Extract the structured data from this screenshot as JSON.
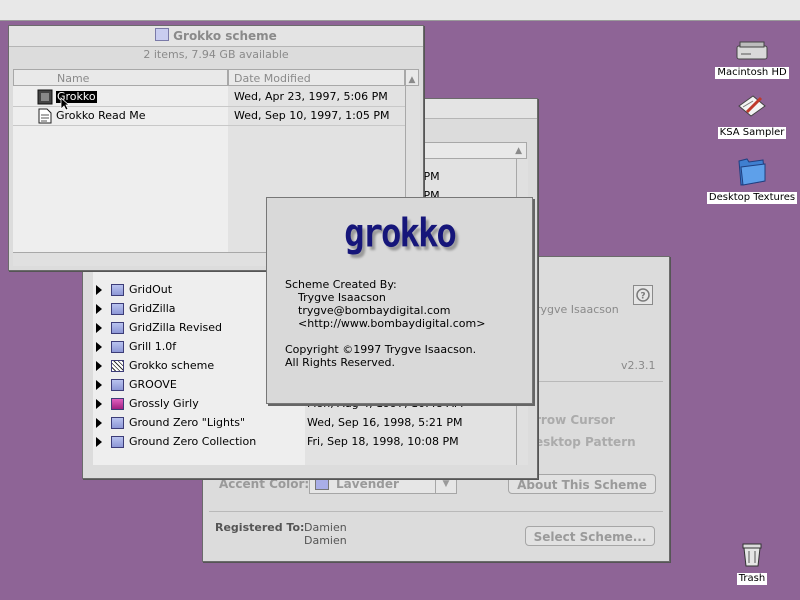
{
  "desktop": {
    "icons": [
      {
        "label": "Macintosh HD"
      },
      {
        "label": "KSA Sampler"
      },
      {
        "label": "Desktop Textures"
      },
      {
        "label": "Trash"
      }
    ]
  },
  "grokko_window": {
    "title": "Grokko scheme",
    "status": "2 items, 7.94 GB available",
    "col_name": "Name",
    "col_date": "Date Modified",
    "items": [
      {
        "name": "Grokko",
        "date": "Wed, Apr 23, 1997, 5:06 PM",
        "selected": true
      },
      {
        "name": "Grokko Read Me",
        "date": "Wed, Sep 10, 1997, 1:05 PM",
        "selected": false
      }
    ]
  },
  "back_window": {
    "rows": [
      {
        "name": "GridOut",
        "date": ""
      },
      {
        "name": "GridZilla",
        "date": ""
      },
      {
        "name": "GridZilla Revised",
        "date": ""
      },
      {
        "name": "Grill 1.0f",
        "date": ""
      },
      {
        "name": "Grokko scheme",
        "date": ""
      },
      {
        "name": "GROOVE",
        "date": ""
      },
      {
        "name": "Grossly Girly",
        "date": "Mon, Aug 4, 1997, 10:48 AM"
      },
      {
        "name": "Ground Zero \"Lights\"",
        "date": "Wed, Sep 16, 1998, 5:21 PM"
      },
      {
        "name": "Ground Zero Collection",
        "date": "Fri, Sep 18, 1998, 10:08 PM"
      }
    ],
    "partial_dates": [
      "3 PM",
      "4 PM"
    ]
  },
  "scheme_panel": {
    "author_partial": "rygve Isaacson",
    "version": "v2.3.1",
    "arrow_cursor_partial": "rrow Cursor",
    "desktop_pattern_partial": "esktop Pattern",
    "accent_label": "Accent Color:",
    "accent_value": "Lavender",
    "about_button": "About This Scheme",
    "registered_label": "Registered To:",
    "registered_name1": "Damien",
    "registered_name2": "Damien",
    "select_button": "Select Scheme..."
  },
  "about_dialog": {
    "logo": "grokko",
    "created_by": "Scheme Created By:",
    "author": "Trygve Isaacson",
    "email": "trygve@bombaydigital.com",
    "url": "<http://www.bombaydigital.com>",
    "copyright": "Copyright ©1997 Trygve Isaacson.",
    "rights": "All Rights Reserved."
  },
  "colors": {
    "desktop": "#8e6496",
    "logo": "#16167a",
    "lavender_swatch": "#a9aee8"
  }
}
